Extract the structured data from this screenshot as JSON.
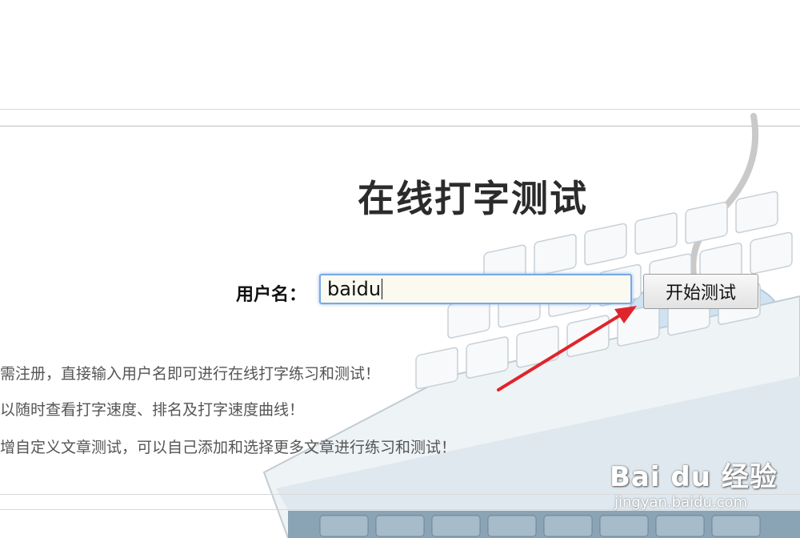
{
  "page": {
    "title": "在线打字测试",
    "username_label": "用户名：",
    "username_value": "baidu",
    "start_button": "开始测试"
  },
  "info_lines": [
    "需注册，直接输入用户名即可进行在线打字练习和测试！",
    "以随时查看打字速度、排名及打字速度曲线！",
    "增自定义文章测试，可以自己添加和选择更多文章进行练习和测试！"
  ],
  "watermark": {
    "logo": "Bai du 经验",
    "url": "jingyan.baidu.com"
  },
  "colors": {
    "accent_arrow": "#e0242b",
    "input_focus": "#78a9e4",
    "keyboard_blue": "#cfe3f3"
  },
  "icons": {
    "arrow": "annotation-arrow",
    "paw": "baidu-paw-icon"
  }
}
